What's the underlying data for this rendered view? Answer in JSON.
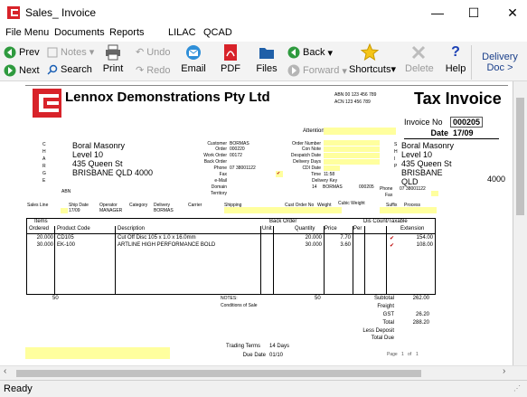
{
  "window": {
    "title": "Sales_ Invoice",
    "minimize": "—",
    "maximize": "☐",
    "close": "✕"
  },
  "menu": [
    "File Menu",
    "Documents",
    "Reports",
    "LILAC",
    "QCAD"
  ],
  "toolbar": {
    "prev": "Prev",
    "next": "Next",
    "notes": "Notes",
    "search": "Search",
    "undo": "Undo",
    "redo": "Redo",
    "print": "Print",
    "email": "Email",
    "pdf": "PDF",
    "files": "Files",
    "back": "Back",
    "forward": "Forward",
    "shortcuts": "Shortcuts",
    "delete": "Delete",
    "help": "Help",
    "delivery_doc": "Delivery Doc >"
  },
  "invoice": {
    "company": "Lennox Demonstrations Pty Ltd",
    "abn": "ABN 00 123 456 789",
    "acn": "ACN 123 456 789",
    "doc_title": "Tax Invoice",
    "attention_label": "Attention",
    "invoice_no_label": "Invoice No",
    "invoice_no": "000205",
    "date_label": "Date",
    "date": "17/09",
    "charge_letters": [
      "C",
      "H",
      "A",
      "R",
      "G",
      "E"
    ],
    "ship_letters": [
      "S",
      "H",
      "I",
      "P"
    ],
    "bill_to": [
      "Boral Masonry",
      "Level 10",
      "435 Queen St",
      "BRISBANE QLD 4000"
    ],
    "ship_to": [
      "Boral Masonry",
      "Level 10",
      "435 Queen St",
      "BRISBANE",
      "QLD"
    ],
    "ship_postcode": "4000",
    "abn_label": "ABN",
    "customer_label": "Customer",
    "customer": "BORMAS",
    "order_label": "Order",
    "order": "000220",
    "work_order_label": "Work Order",
    "work_order": "00172",
    "back_order_label": "Back Order",
    "phone_label": "Phone",
    "phone": "07 38001122",
    "fax_label": "Fax",
    "fax_mark": "✔",
    "email_label": "e-Mail",
    "domain_label": "Domain",
    "territory_label": "Territory",
    "order_number_label": "Order Number",
    "con_note_label": "Con Note",
    "despatch_date_label": "Despatch Date",
    "delivery_days_label": "Delivery Days",
    "cdi_date_label": "CDI Date",
    "time_label": "Time",
    "time": "11:58",
    "delivery_key_label": "Delivery Key",
    "dk_value1": "14",
    "dk_value2": "BORMAS",
    "dk_value3": "000205",
    "ship_phone_label": "Phone",
    "ship_phone": "07 38001122",
    "ship_fax_label": "Fax",
    "row_labels": [
      "Sales Line",
      "Ship Date",
      "Operator",
      "Category",
      "Delivery",
      "Carrier",
      "Shipping",
      "Cust Order No",
      "Weight",
      "Cubic Weight",
      "Suffix",
      "Process"
    ],
    "row_values": {
      "ship_date": "17/09",
      "operator": "MANAGER",
      "delivery": "BORMAS"
    },
    "items_header": {
      "items": "Items",
      "back_order": "Back Order",
      "disc_taxable": "Dis Count/Taxable",
      "ordered": "Ordered",
      "product_code": "Product Code",
      "description": "Description",
      "unit": "Unit",
      "quantity": "Quantity",
      "price": "Price",
      "per": "Per",
      "extension": "Extension"
    },
    "lines": [
      {
        "ordered": "20.000",
        "code": "CD105",
        "desc": "Cut Off Disc 105 x 1.0 x 16.0mm",
        "qty": "20.000",
        "price": "7.70",
        "tax": "✔",
        "ext": "154.00"
      },
      {
        "ordered": "30.000",
        "code": "EK-100",
        "desc": "ARTLINE HIGH PERFORMANCE BOLD",
        "qty": "30.000",
        "price": "3.60",
        "tax": "✔",
        "ext": "108.00"
      }
    ],
    "total_ordered": "50",
    "notes_label": "NOTES:",
    "conditions": "Conditions of Sale",
    "total_qty": "50",
    "subtotal_label": "Subtotal",
    "subtotal": "262.00",
    "freight_label": "Freight",
    "gst_label": "GST",
    "gst": "26.20",
    "total_label": "Total",
    "total": "288.20",
    "less_deposit_label": "Less Deposit",
    "total_due_label": "Total Due",
    "trading_terms_label": "Trading Terms",
    "trading_terms": "14 Days",
    "due_date_label": "Due Date",
    "due_date": "01/10",
    "page_label": "Page",
    "page_no": "1",
    "of_label": "of",
    "page_total": "1"
  },
  "status": "Ready",
  "colors": {
    "logo_red": "#d8232a",
    "field_yellow": "#ffff9e",
    "toolbar_bg": "#f3f3f3",
    "link_blue": "#1a5fb4"
  }
}
